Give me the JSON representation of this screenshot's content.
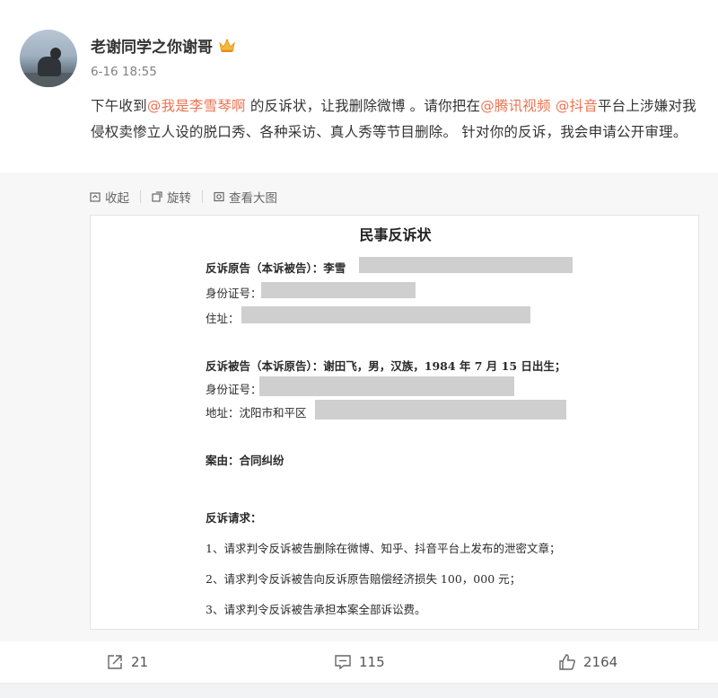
{
  "post": {
    "username": "老谢同学之你谢哥",
    "timestamp": "6-16 18:55",
    "text_parts": {
      "p1": "下午收到",
      "m1": "@我是李雪琴啊",
      "p2": " 的反诉状，让我删除微博 。请你把在",
      "m2": "@腾讯视频",
      "p3": " ",
      "m3": "@抖音",
      "p4": "平台上涉嫌对我侵权卖惨立人设的脱口秀、各种采访、真人秀等节目删除。 针对你的反诉，我会申请公开审理。"
    },
    "mention_color": "#eb7350"
  },
  "media_toolbar": {
    "collapse_label": "收起",
    "rotate_label": "旋转",
    "view_large_label": "查看大图"
  },
  "document": {
    "title": "民事反诉状",
    "lines": {
      "plaintiff": "反诉原告（本诉被告）：李雪",
      "id1": "身份证号：",
      "address1": "住址：",
      "defendant": "反诉被告（本诉原告）：谢田飞，男，汉族，1984 年 7 月 15 日出生；",
      "id2": "身份证号：",
      "address2": "地址：沈阳市和平区",
      "case": "案由：合同纠纷",
      "claims_title": "反诉请求：",
      "claim1": "1、请求判令反诉被告删除在微博、知乎、抖音平台上发布的泄密文章；",
      "claim2": "2、请求判令反诉被告向反诉原告赔偿经济损失 100，000 元；",
      "claim3": "3、请求判令反诉被告承担本案全部诉讼费。"
    }
  },
  "actions": {
    "reposts": "21",
    "comments": "115",
    "likes": "2164"
  }
}
